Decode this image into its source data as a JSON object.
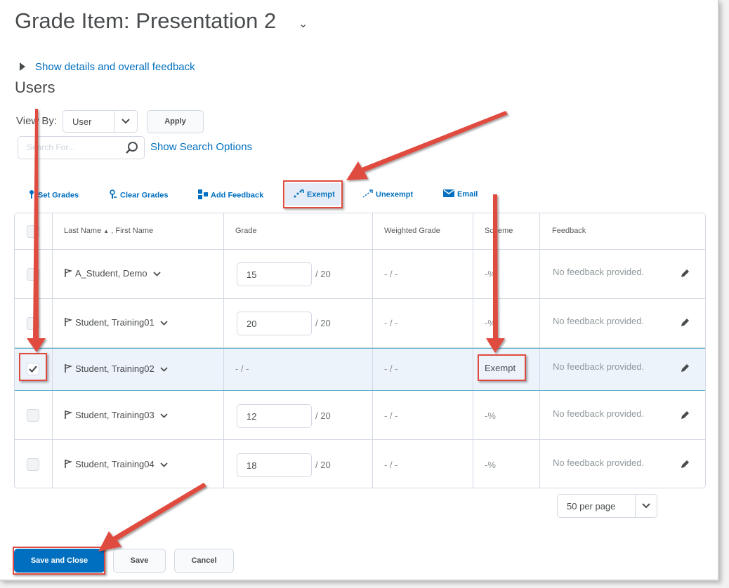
{
  "page": {
    "title": "Grade Item: Presentation 2",
    "show_details": "Show details and overall feedback",
    "section": "Users"
  },
  "filters": {
    "view_by_label": "View By:",
    "view_by_value": "User",
    "apply": "Apply",
    "search_placeholder": "Search For...",
    "search_options": "Show Search Options"
  },
  "toolbar": {
    "set_grades": "Set Grades",
    "clear_grades": "Clear Grades",
    "add_feedback": "Add Feedback",
    "exempt": "Exempt",
    "unexempt": "Unexempt",
    "email": "Email"
  },
  "table": {
    "headers": {
      "name": "Last Name",
      "name_sep": ", First Name",
      "grade": "Grade",
      "weighted": "Weighted Grade",
      "scheme": "Scheme",
      "feedback": "Feedback"
    },
    "rows": [
      {
        "name": "A_Student, Demo",
        "grade": "15",
        "grade_max": "/ 20",
        "weighted": "- / -",
        "scheme": "-%",
        "feedback": "No feedback provided.",
        "checked": false
      },
      {
        "name": "Student, Training01",
        "grade": "20",
        "grade_max": "/ 20",
        "weighted": "- / -",
        "scheme": "-%",
        "feedback": "No feedback provided.",
        "checked": false
      },
      {
        "name": "Student, Training02",
        "grade": "- / -",
        "grade_max": "",
        "weighted": "- / -",
        "scheme": "Exempt",
        "feedback": "No feedback provided.",
        "checked": true
      },
      {
        "name": "Student, Training03",
        "grade": "12",
        "grade_max": "/ 20",
        "weighted": "- / -",
        "scheme": "-%",
        "feedback": "No feedback provided.",
        "checked": false
      },
      {
        "name": "Student, Training04",
        "grade": "18",
        "grade_max": "/ 20",
        "weighted": "- / -",
        "scheme": "-%",
        "feedback": "No feedback provided.",
        "checked": false
      }
    ]
  },
  "pagination": {
    "per_page": "50 per page"
  },
  "actions": {
    "save_and_close": "Save and Close",
    "save": "Save",
    "cancel": "Cancel"
  },
  "colors": {
    "link": "#006fbf",
    "primary": "#006fbf",
    "annotation": "#e04b3f"
  }
}
